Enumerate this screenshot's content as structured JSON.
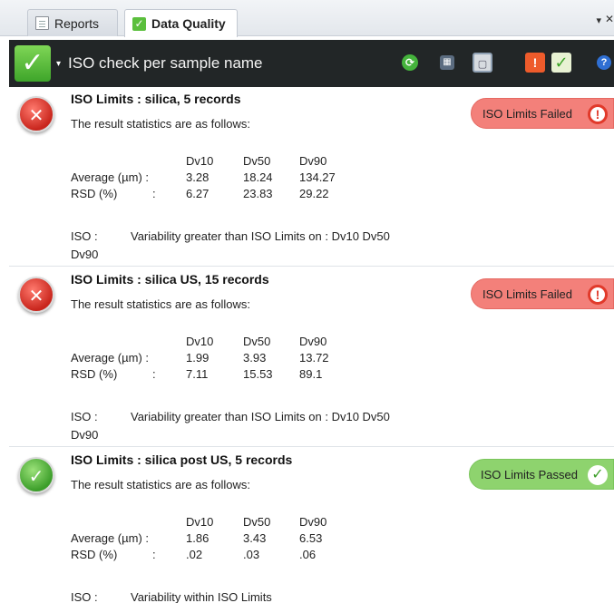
{
  "tabs": [
    {
      "label": "Reports",
      "icon": "report-doc-icon",
      "active": false
    },
    {
      "label": "Data Quality",
      "icon": "data-quality-check-icon",
      "active": true
    }
  ],
  "tab_menu_glyph": "▾",
  "tab_close_glyph": "✕",
  "toolbar": {
    "title": "ISO check per sample name",
    "main_icon": "green-check-icon",
    "dropdown_glyph": "▾",
    "icons": [
      "refresh-icon",
      "grid-icon",
      "frame-icon",
      "alert-icon",
      "ok-check-icon",
      "help-icon"
    ]
  },
  "records": [
    {
      "title": "ISO Limits : silica,  5 records",
      "subtitle": "The result statistics are as follows:",
      "status": "failed",
      "badge": "ISO Limits Failed",
      "headers": [
        "Dv10",
        "Dv50",
        "Dv90"
      ],
      "average_label": "Average (µm) :",
      "average": [
        "3.28",
        "18.24",
        "134.27"
      ],
      "rsd_label": "RSD (%)",
      "rsd_colon": ":",
      "rsd": [
        "6.27",
        "23.83",
        "29.22"
      ],
      "iso_label": "ISO :",
      "iso_text": "Variability greater than ISO Limits on : Dv10  Dv50",
      "iso_text_cont": "Dv90"
    },
    {
      "title": "ISO Limits : silica US,  15 records",
      "subtitle": "The result statistics are as follows:",
      "status": "failed",
      "badge": "ISO Limits Failed",
      "headers": [
        "Dv10",
        "Dv50",
        "Dv90"
      ],
      "average_label": "Average (µm) :",
      "average": [
        "1.99",
        "3.93",
        "13.72"
      ],
      "rsd_label": "RSD (%)",
      "rsd_colon": ":",
      "rsd": [
        "7.11",
        "15.53",
        "89.1"
      ],
      "iso_label": "ISO :",
      "iso_text": "Variability greater than ISO Limits on :  Dv10  Dv50",
      "iso_text_cont": "Dv90"
    },
    {
      "title": "ISO Limits : silica post US,  5 records",
      "subtitle": "The result statistics are as follows:",
      "status": "passed",
      "badge": "ISO Limits Passed",
      "headers": [
        "Dv10",
        "Dv50",
        "Dv90"
      ],
      "average_label": "Average (µm) :",
      "average": [
        "1.86",
        "3.43",
        "6.53"
      ],
      "rsd_label": "RSD (%)",
      "rsd_colon": ":",
      "rsd": [
        ".02",
        ".03",
        ".06"
      ],
      "iso_label": "ISO :",
      "iso_text": "Variability within ISO Limits",
      "iso_text_cont": ""
    }
  ],
  "colors": {
    "toolbar_bg": "#222627",
    "fail_badge": "#f3807a",
    "pass_badge": "#8ed36e",
    "fail_orb": "#c9261d",
    "pass_orb": "#3c9e2a"
  }
}
